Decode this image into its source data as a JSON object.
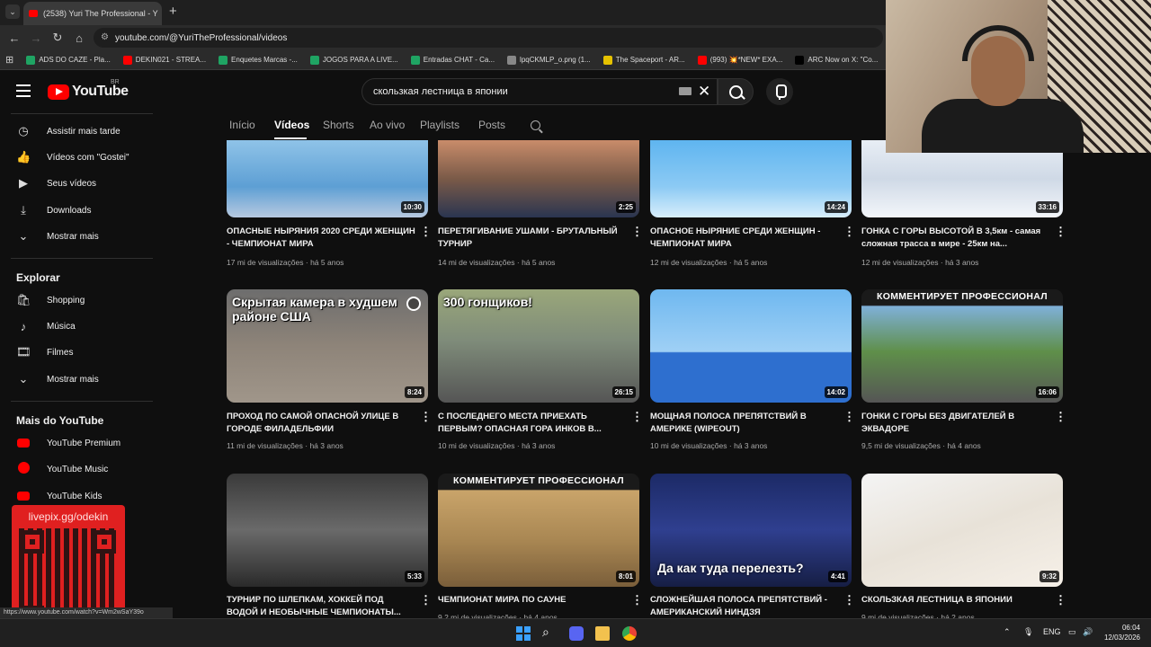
{
  "browser": {
    "tab_title": "(2538) Yuri The Professional - Y",
    "url": "youtube.com/@YuriTheProfessional/videos",
    "bookmarks": [
      {
        "label": "ADS DO CAZE - Pla...",
        "color": "#1fa463"
      },
      {
        "label": "DEKIN021 - STREA...",
        "color": "#ff0000"
      },
      {
        "label": "Enquetes Marcas -...",
        "color": "#1fa463"
      },
      {
        "label": "JOGOS PARA A LIVE...",
        "color": "#1fa463"
      },
      {
        "label": "Entradas CHAT - Ca...",
        "color": "#1fa463"
      },
      {
        "label": "lpqCKMLP_o.png (1...",
        "color": "#888888"
      },
      {
        "label": "The Spaceport - AR...",
        "color": "#e6c200"
      },
      {
        "label": "(993) 💥*NEW* EXA...",
        "color": "#ff0000"
      },
      {
        "label": "ARC Now on X: \"Co...",
        "color": "#000000"
      }
    ]
  },
  "header": {
    "logo_text": "YouTube",
    "country_code": "BR",
    "search_value": "скользкая лестница в японии"
  },
  "sidebar": {
    "you_items": [
      {
        "label": "Assistir mais tarde",
        "icon": "clock-icon",
        "glyph": "◷"
      },
      {
        "label": "Vídeos com \"Gostei\"",
        "icon": "thumbs-up-icon",
        "glyph": "👍"
      },
      {
        "label": "Seus vídeos",
        "icon": "video-icon",
        "glyph": "▶"
      },
      {
        "label": "Downloads",
        "icon": "download-icon",
        "glyph": "⤓"
      },
      {
        "label": "Mostrar mais",
        "icon": "chevron-down-icon",
        "glyph": "⌄"
      }
    ],
    "explore_title": "Explorar",
    "explore_items": [
      {
        "label": "Shopping",
        "icon": "shopping-bag-icon",
        "glyph": "🛍"
      },
      {
        "label": "Música",
        "icon": "music-note-icon",
        "glyph": "♪"
      },
      {
        "label": "Filmes",
        "icon": "film-icon",
        "glyph": "🎞"
      },
      {
        "label": "Mostrar mais",
        "icon": "chevron-down-icon",
        "glyph": "⌄"
      }
    ],
    "more_title": "Mais do YouTube",
    "more_items": [
      {
        "label": "YouTube Premium"
      },
      {
        "label": "YouTube Music"
      },
      {
        "label": "YouTube Kids"
      }
    ]
  },
  "channel_tabs": [
    "Início",
    "Vídeos",
    "Shorts",
    "Ao vivo",
    "Playlists",
    "Posts"
  ],
  "videos": [
    {
      "title": "ОПАСНЫЕ НЫРЯНИЯ 2020 СРЕДИ ЖЕНЩИН - ЧЕМПИОНАТ МИРА",
      "views": "17 mi de visualizações",
      "age": "há 5 anos",
      "duration": "10:30",
      "bg": "linear-gradient(180deg,#8fc3e8,#5d9fd4 60%,#b7c9e0)"
    },
    {
      "title": "ПЕРЕТЯГИВАНИЕ УШАМИ - БРУТАЛЬНЫЙ ТУРНИР",
      "views": "14 mi de visualizações",
      "age": "há 5 anos",
      "duration": "2:25",
      "bg": "linear-gradient(180deg,#c98c6a,#7a5a48 50%,#2a3550)"
    },
    {
      "title": "ОПАСНОЕ НЫРЯНИЕ СРЕДИ ЖЕНЩИН - ЧЕМПИОНАТ МИРА",
      "views": "12 mi de visualizações",
      "age": "há 5 anos",
      "duration": "14:24",
      "bg": "linear-gradient(180deg,#5fb5f0,#8ccaf4 60%,#d8eefb)"
    },
    {
      "title": "ГОНКА С ГОРЫ ВЫСОТОЙ В 3,5км - самая сложная трасса в мире - 25км на...",
      "views": "12 mi de visualizações",
      "age": "há 3 anos",
      "duration": "33:16",
      "bg": "linear-gradient(180deg,#e8eef5,#cfd9e6 50%,#f3f6fa)"
    },
    {
      "title": "ПРОХОД ПО САМОЙ ОПАСНОЙ УЛИЦЕ В ГОРОДЕ ФИЛАДЕЛЬФИИ",
      "views": "11 mi de visualizações",
      "age": "há 3 anos",
      "duration": "8:24",
      "bg": "linear-gradient(180deg,#6d6d6d,#8e8479 50%,#a0968a)",
      "overlay": "Скрытая камера в худшем районе США"
    },
    {
      "title": "С ПОСЛЕДНЕГО МЕСТА ПРИЕХАТЬ ПЕРВЫМ? ОПАСНАЯ ГОРА ИНКОВ В...",
      "views": "10 mi de visualizações",
      "age": "há 3 anos",
      "duration": "26:15",
      "bg": "linear-gradient(180deg,#9aa77a,#7f8c7a 45%,#555 100%)",
      "overlay": "300 гонщиков!"
    },
    {
      "title": "МОЩНАЯ ПОЛОСА ПРЕПЯТСТВИЙ В АМЕРИКЕ (WIPEOUT)",
      "views": "10 mi de visualizações",
      "age": "há 3 anos",
      "duration": "14:02",
      "bg": "linear-gradient(180deg,#6fb8f0,#9fd0f5 55%,#2e6fcf 56%,#2e6fcf)"
    },
    {
      "title": "ГОНКИ С ГОРЫ БЕЗ ДВИГАТЕЛЕЙ В ЭКВАДОРЕ",
      "views": "9,5 mi de visualizações",
      "age": "há 4 anos",
      "duration": "16:06",
      "bg": "linear-gradient(180deg,#1a1a1a 0,#1a1a1a 14%,#7fb0d8 15%,#5f8f4a 55%,#555)",
      "banner": "КОММЕНТИРУЕТ ПРОФЕССИОНАЛ"
    },
    {
      "title": "ТУРНИР ПО ШЛЕПКАМ, ХОККЕЙ ПОД ВОДОЙ И НЕОБЫЧНЫЕ ЧЕМПИОНАТЫ...",
      "views": "",
      "age": "",
      "duration": "5:33",
      "bg": "linear-gradient(180deg,#3a3a3a,#6a6a6a 50%,#2a2a2a)"
    },
    {
      "title": "ЧЕМПИОНАТ МИРА ПО САУНЕ",
      "views": "9,2 mi de visualizações",
      "age": "há 4 anos",
      "duration": "8:01",
      "bg": "linear-gradient(180deg,#1a1a1a 0,#1a1a1a 14%,#c9a46a 15%,#a88652 60%,#7a5e3a)",
      "banner": "КОММЕНТИРУЕТ ПРОФЕССИОНАЛ"
    },
    {
      "title": "СЛОЖНЕЙШАЯ ПОЛОСА ПРЕПЯТСТВИЙ - АМЕРИКАНСКИЙ НИНДЗЯ",
      "views": "",
      "age": "",
      "duration": "4:41",
      "bg": "linear-gradient(180deg,#1c2a66,#2f3f8f 50%,#161e44)",
      "overlay2": "Да как туда перелезть?"
    },
    {
      "title": "СКОЛЬЗКАЯ ЛЕСТНИЦА В ЯПОНИИ",
      "views": "9 mi de visualizações",
      "age": "há 2 anos",
      "duration": "9:32",
      "bg": "linear-gradient(160deg,#f4f4f4,#e8e2d8 50%,#f6f0e8)"
    }
  ],
  "overlays": {
    "qr_text": "livepix.gg/odekin",
    "status_link": "https://www.youtube.com/watch?v=Wm2wSaY39o"
  },
  "taskbar": {
    "lang": "ENG",
    "time": "06:04",
    "date": "12/03/2026"
  }
}
